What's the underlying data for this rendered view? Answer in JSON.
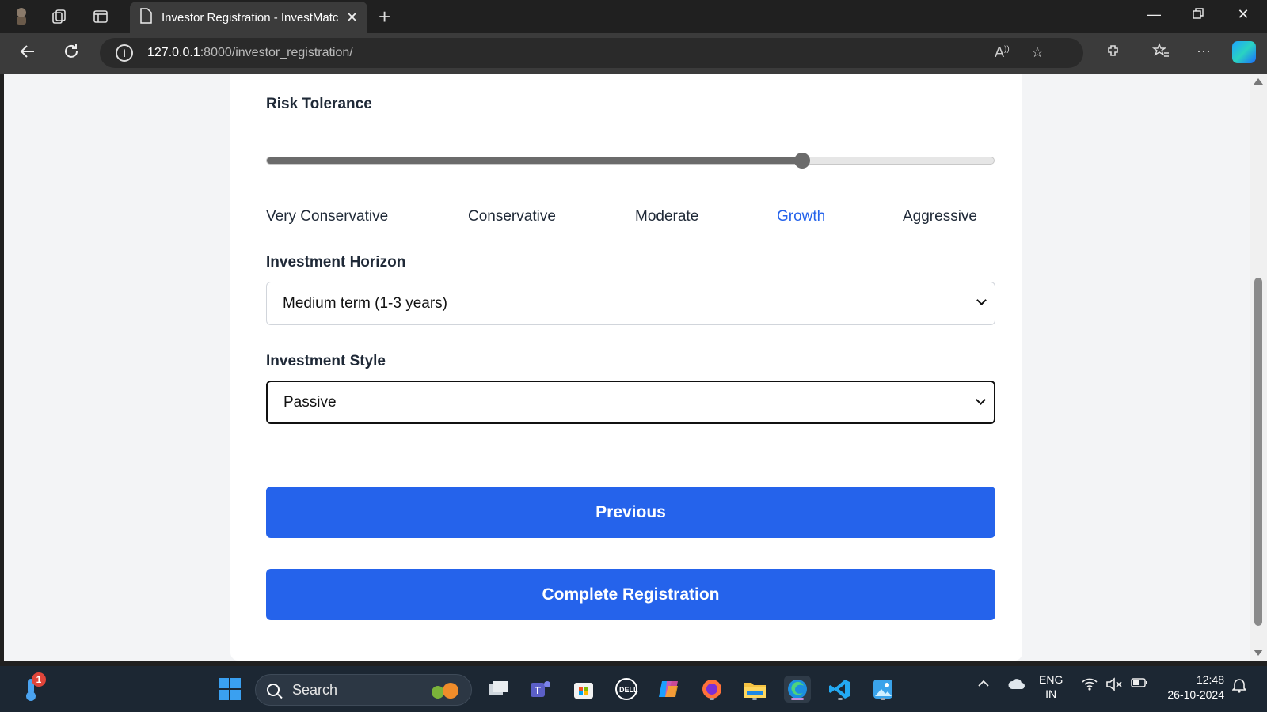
{
  "browser": {
    "tab_title": "Investor Registration - InvestMatc",
    "url_host": "127.0.0.1",
    "url_path": ":8000/investor_registration/"
  },
  "form": {
    "risk_tolerance": {
      "label": "Risk Tolerance",
      "slider_value": 0.736,
      "options": [
        "Very Conservative",
        "Conservative",
        "Moderate",
        "Growth",
        "Aggressive"
      ],
      "selected": "Growth"
    },
    "investment_horizon": {
      "label": "Investment Horizon",
      "value": "Medium term (1-3 years)"
    },
    "investment_style": {
      "label": "Investment Style",
      "value": "Passive"
    },
    "buttons": {
      "previous": "Previous",
      "complete": "Complete Registration"
    }
  },
  "taskbar": {
    "search_placeholder": "Search",
    "notification_count": "1",
    "lang_line1": "ENG",
    "lang_line2": "IN",
    "time": "12:48",
    "date": "26-10-2024"
  },
  "colors": {
    "primary_button": "#2563eb",
    "selected_option": "#2563eb"
  }
}
